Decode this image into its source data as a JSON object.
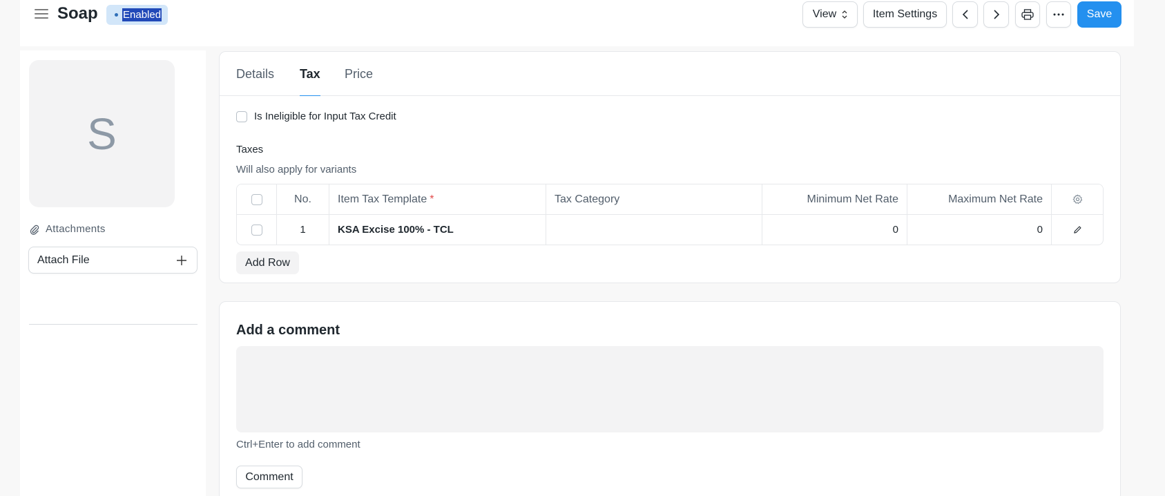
{
  "header": {
    "title": "Soap",
    "status": "Enabled",
    "view_label": "View",
    "item_settings_label": "Item Settings",
    "save_label": "Save",
    "icons": [
      "hamburger-icon",
      "chevron-left-icon",
      "chevron-right-icon",
      "printer-icon",
      "more-icon"
    ]
  },
  "sidebar": {
    "avatar_letter": "S",
    "attachments_label": "Attachments",
    "attach_file_label": "Attach File"
  },
  "tabs": [
    {
      "label": "Details",
      "active": false
    },
    {
      "label": "Tax",
      "active": true
    },
    {
      "label": "Price",
      "active": false
    }
  ],
  "tax_section": {
    "ineligible_label": "Is Ineligible for Input Tax Credit",
    "ineligible_checked": false,
    "taxes_label": "Taxes",
    "taxes_description": "Will also apply for variants",
    "columns": {
      "no": "No.",
      "template": "Item Tax Template",
      "required_marker": "*",
      "category": "Tax Category",
      "min_rate": "Minimum Net Rate",
      "max_rate": "Maximum Net Rate"
    },
    "rows": [
      {
        "no": "1",
        "template": "KSA Excise 100% - TCL",
        "category": "",
        "min_rate": "0",
        "max_rate": "0"
      }
    ],
    "add_row_label": "Add Row"
  },
  "comments": {
    "title": "Add a comment",
    "hint": "Ctrl+Enter to add comment",
    "button_label": "Comment"
  },
  "colors": {
    "primary": "#2490ef",
    "badge_bg": "#d2e6f9",
    "required": "#e24c4c"
  }
}
